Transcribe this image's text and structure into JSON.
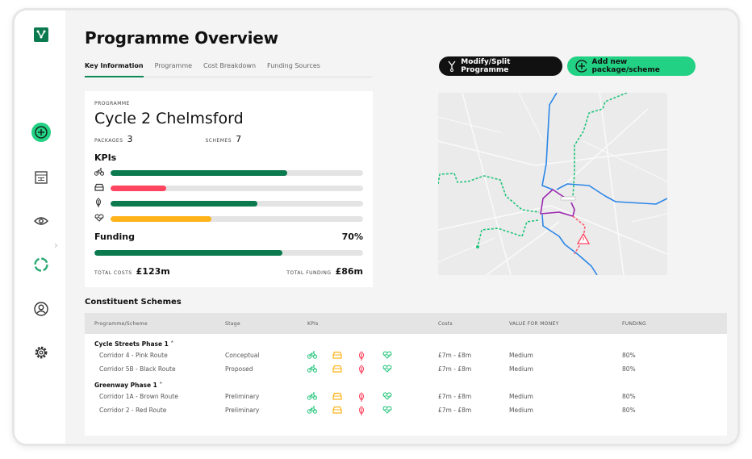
{
  "header": {
    "title": "Programme Overview"
  },
  "tabs": [
    {
      "label": "Key Information",
      "active": true
    },
    {
      "label": "Programme"
    },
    {
      "label": "Cost Breakdown"
    },
    {
      "label": "Funding Sources"
    }
  ],
  "actions": {
    "modify": "Modify/Split Programme",
    "add": "Add new package/scheme"
  },
  "sidebar": {
    "items": [
      "add-icon",
      "table-icon",
      "eye-icon",
      "cycle-icon",
      "user-icon",
      "gear-icon"
    ],
    "active": "cycle-icon"
  },
  "programme": {
    "label": "Programme",
    "name": "Cycle 2 Chelmsford",
    "packages_label": "Packages",
    "packages": "3",
    "schemes_label": "Schemes",
    "schemes": "7",
    "kpis_title": "KPIs",
    "kpis": [
      {
        "icon": "bike-icon",
        "value": 0.7,
        "color": "#0b7a4f"
      },
      {
        "icon": "car-icon",
        "value": 0.22,
        "color": "#ff4560"
      },
      {
        "icon": "leaf-icon",
        "value": 0.58,
        "color": "#0b7a4f"
      },
      {
        "icon": "heart-icon",
        "value": 0.4,
        "color": "#ffb31a"
      }
    ],
    "funding_label": "Funding",
    "funding_pct": "70%",
    "funding_value": 0.7,
    "total_costs_label": "Total costs",
    "total_costs": "£123m",
    "total_funding_label": "Total funding",
    "total_funding": "£86m"
  },
  "schemes": {
    "title": "Constituent Schemes",
    "columns": [
      "Programme/Scheme",
      "Stage",
      "KPIs",
      "Costs",
      "Value for money",
      "Funding"
    ],
    "groups": [
      {
        "name": "Cycle Streets Phase 1 ^",
        "rows": [
          {
            "name": "Corridor 4 - Pink Route",
            "stage": "Conceptual",
            "costs": "£7m - £8m",
            "vfm": "Medium",
            "funding": "80%"
          },
          {
            "name": "Corridor 5B - Black Route",
            "stage": "Proposed",
            "costs": "£7m - £8m",
            "vfm": "Medium",
            "funding": "80%"
          }
        ]
      },
      {
        "name": "Greenway Phase 1 ^",
        "rows": [
          {
            "name": "Corridor 1A - Brown Route",
            "stage": "Preliminary",
            "costs": "£7m - £8m",
            "vfm": "Medium",
            "funding": "80%"
          },
          {
            "name": "Corridor 2 - Red Route",
            "stage": "Preliminary",
            "costs": "£7m - £8m",
            "vfm": "Medium",
            "funding": "80%"
          }
        ]
      }
    ],
    "kpi_colors": [
      "#22c47a",
      "#ffb31a",
      "#ff4560",
      "#22c47a"
    ]
  },
  "colors": {
    "brand": "#0b7a4f",
    "accent": "#22d184"
  }
}
